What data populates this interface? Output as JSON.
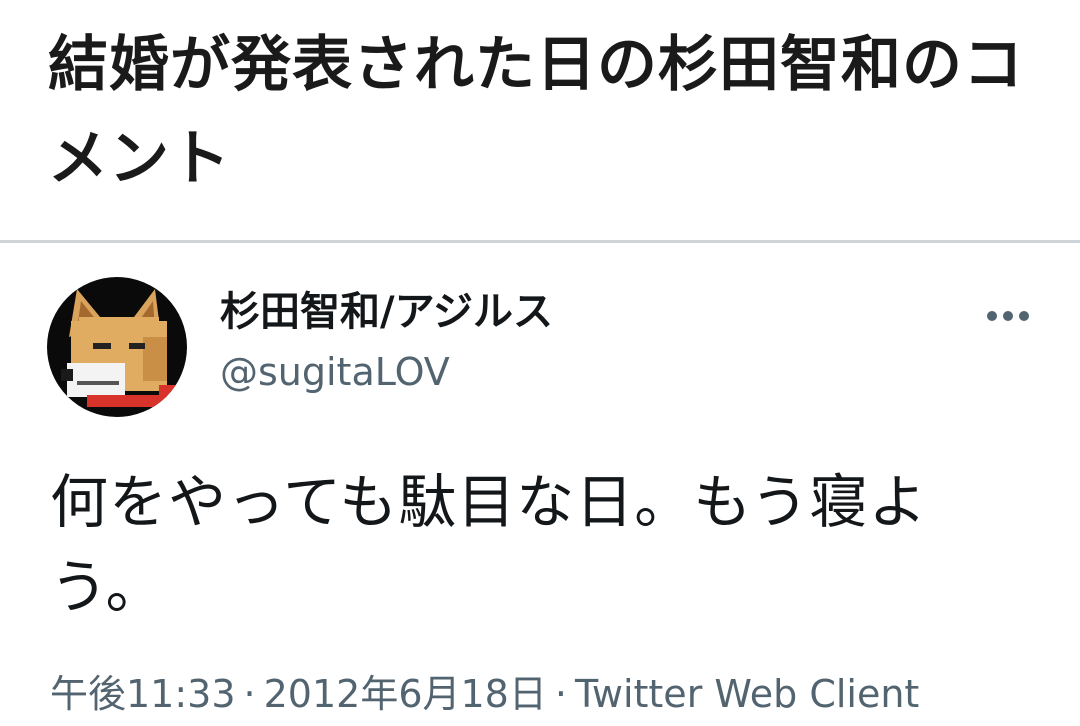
{
  "article": {
    "headline": "結婚が発表された日の杉田智和のコメント"
  },
  "tweet": {
    "author": {
      "display_name": "杉田智和/アジルス",
      "handle": "@sugitaLOV",
      "avatar": "pixel-dog-avatar"
    },
    "more_icon": "more-horizontal-icon",
    "text": "何をやっても駄目な日。もう寝よう。",
    "time": "午後11:33",
    "date": "2012年6月18日",
    "source": "Twitter Web Client",
    "separator": "·"
  },
  "colors": {
    "text_primary": "#14171a",
    "text_secondary": "#536471",
    "divider": "#cfd4d8",
    "background": "#ffffff"
  }
}
